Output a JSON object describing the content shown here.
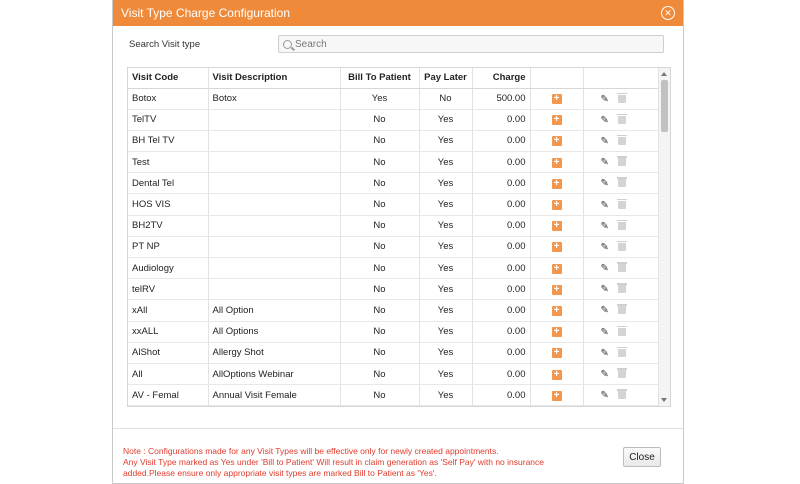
{
  "dialog": {
    "title": "Visit Type Charge Configuration",
    "close_icon": "close-circle-icon",
    "accent_color": "#ef8a3a"
  },
  "search": {
    "label": "Search Visit type",
    "placeholder": "Search",
    "value": ""
  },
  "table": {
    "columns": [
      "Visit Code",
      "Visit Description",
      "Bill To Patient",
      "Pay Later",
      "Charge",
      "",
      ""
    ],
    "rows": [
      {
        "code": "Botox",
        "description": "Botox",
        "bill": "Yes",
        "pay_later": "No",
        "charge": "500.00"
      },
      {
        "code": "TelTV",
        "description": "",
        "bill": "No",
        "pay_later": "Yes",
        "charge": "0.00"
      },
      {
        "code": "BH Tel TV",
        "description": "",
        "bill": "No",
        "pay_later": "Yes",
        "charge": "0.00"
      },
      {
        "code": "Test",
        "description": "",
        "bill": "No",
        "pay_later": "Yes",
        "charge": "0.00"
      },
      {
        "code": "Dental Tel",
        "description": "",
        "bill": "No",
        "pay_later": "Yes",
        "charge": "0.00"
      },
      {
        "code": "HOS VIS",
        "description": "",
        "bill": "No",
        "pay_later": "Yes",
        "charge": "0.00"
      },
      {
        "code": "BH2TV",
        "description": "",
        "bill": "No",
        "pay_later": "Yes",
        "charge": "0.00"
      },
      {
        "code": "PT NP",
        "description": "",
        "bill": "No",
        "pay_later": "Yes",
        "charge": "0.00"
      },
      {
        "code": "Audiology",
        "description": "",
        "bill": "No",
        "pay_later": "Yes",
        "charge": "0.00"
      },
      {
        "code": "telRV",
        "description": "",
        "bill": "No",
        "pay_later": "Yes",
        "charge": "0.00"
      },
      {
        "code": "xAll",
        "description": "All Option",
        "bill": "No",
        "pay_later": "Yes",
        "charge": "0.00"
      },
      {
        "code": "xxALL",
        "description": "All Options",
        "bill": "No",
        "pay_later": "Yes",
        "charge": "0.00"
      },
      {
        "code": "AlShot",
        "description": "Allergy Shot",
        "bill": "No",
        "pay_later": "Yes",
        "charge": "0.00"
      },
      {
        "code": "All",
        "description": "AllOptions Webinar",
        "bill": "No",
        "pay_later": "Yes",
        "charge": "0.00"
      },
      {
        "code": "AV - Femal",
        "description": "Annual Visit Female",
        "bill": "No",
        "pay_later": "Yes",
        "charge": "0.00"
      }
    ],
    "row_icons": {
      "add": "plus-square-icon",
      "edit": "pencil-icon",
      "delete": "trash-icon"
    }
  },
  "footer": {
    "note_line1": "Note : Configurations made for any Visit Types will be effective only for newly created appointments.",
    "note_line2": "Any Visit Type marked as Yes under 'Bill to Patient' Will result in claim generation as 'Self Pay' with no insurance added.Please ensure only appropriate visit types are marked Bill to Patient as 'Yes'.",
    "note_color": "#e03b2b",
    "close_label": "Close"
  }
}
